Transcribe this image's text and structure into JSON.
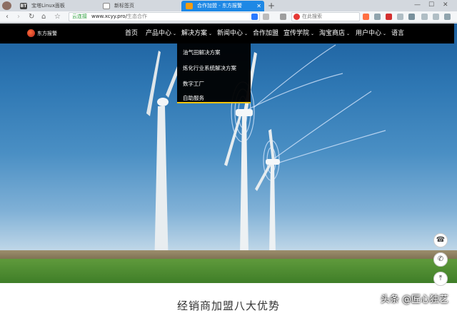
{
  "browser": {
    "tabs": [
      {
        "label": "宝塔Linux面板",
        "icon": "BT",
        "color": "#444444"
      },
      {
        "label": "新标签页",
        "icon": "",
        "color": "#888888"
      },
      {
        "label": "合作加盟 - 东方报警",
        "icon": "",
        "color": "#1e88e5",
        "active": true
      }
    ],
    "newtab_label": "+",
    "address": {
      "secure_label": "云连接",
      "url": "www.xcyy.pro/",
      "path": "生态合作"
    },
    "search_placeholder": "在此搜索",
    "window_controls": [
      "—",
      "☐",
      "✕"
    ]
  },
  "site": {
    "logo_text": "东方报警",
    "nav": [
      {
        "label": "首页",
        "caret": false
      },
      {
        "label": "产品中心",
        "caret": true
      },
      {
        "label": "解决方案",
        "caret": true
      },
      {
        "label": "新闻中心",
        "caret": true
      },
      {
        "label": "合作加盟",
        "caret": false
      },
      {
        "label": "宣传学院",
        "caret": true
      },
      {
        "label": "淘宝商店",
        "caret": true
      },
      {
        "label": "用户中心",
        "caret": true
      },
      {
        "label": "语言",
        "caret": false
      }
    ],
    "dropdown": [
      "油气田解决方案",
      "炼化行业系统解决方案",
      "数字工厂",
      "自助服务"
    ],
    "caret_glyph": "⌄",
    "section_title": "经销商加盟八大优势",
    "watermark": "头条 @匠心独艺"
  },
  "colors": {
    "accent": "#f1c40f",
    "tab_active": "#1e88e5",
    "nav_bg": "#000000"
  }
}
